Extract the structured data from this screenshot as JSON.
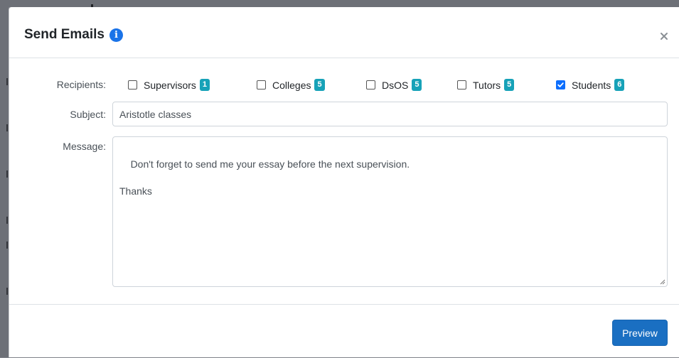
{
  "modal": {
    "title": "Send Emails",
    "info_icon": "i",
    "close_icon": "close-icon"
  },
  "form": {
    "recipients_label": "Recipients:",
    "subject_label": "Subject:",
    "message_label": "Message:",
    "recipients": [
      {
        "label": "Supervisors",
        "count": "1",
        "checked": false
      },
      {
        "label": "Colleges",
        "count": "5",
        "checked": false
      },
      {
        "label": "DsOS",
        "count": "5",
        "checked": false
      },
      {
        "label": "Tutors",
        "count": "5",
        "checked": false
      },
      {
        "label": "Students",
        "count": "6",
        "checked": true
      }
    ],
    "subject_value": "Aristotle classes",
    "message_value": "Don't forget to send me your essay before the next supervision.\n\nThanks"
  },
  "footer": {
    "preview_label": "Preview"
  },
  "colors": {
    "badge": "#17a2b8",
    "primary": "#1a6fc2",
    "checkbox_checked": "#0d6efd",
    "info_icon": "#1a73e8"
  }
}
